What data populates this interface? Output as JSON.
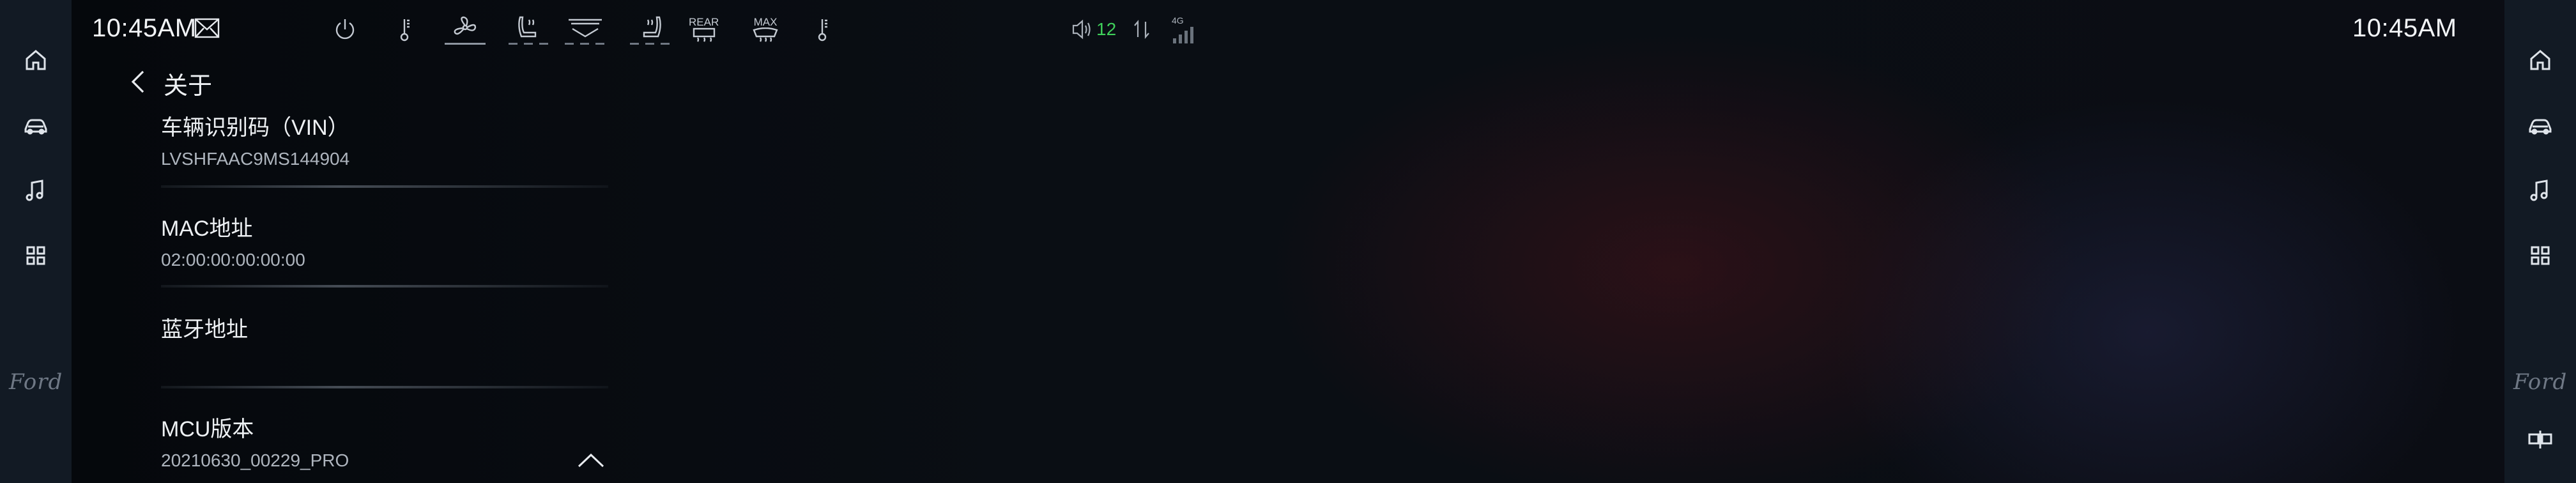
{
  "status_bar": {
    "time_left": "10:45AM",
    "time_right": "10:45AM",
    "climate": {
      "rear_label": "REAR",
      "max_label": "MAX"
    },
    "network": {
      "volume_level": "12",
      "signal_label": "4G"
    },
    "accent_green": "#3fcf5a"
  },
  "sidebar_left": {
    "items": [
      "home-icon",
      "car-icon",
      "music-note-icon",
      "apps-grid-icon"
    ],
    "brand_logo": "Ford"
  },
  "sidebar_right": {
    "items": [
      "home-icon",
      "car-icon",
      "music-note-icon",
      "apps-grid-icon",
      "split-screen-icon"
    ],
    "brand_logo": "Ford"
  },
  "page": {
    "title": "关于",
    "items": [
      {
        "label": "车辆识别码（VIN）",
        "value": "LVSHFAAC9MS144904"
      },
      {
        "label": "MAC地址",
        "value": "02:00:00:00:00:00"
      },
      {
        "label": "蓝牙地址",
        "value": ""
      },
      {
        "label": "MCU版本",
        "value": "20210630_00229_PRO"
      }
    ]
  }
}
